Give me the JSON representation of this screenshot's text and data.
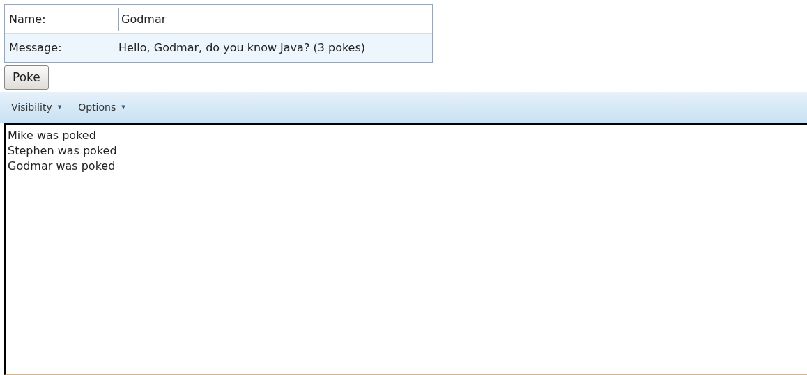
{
  "form": {
    "rows": [
      {
        "kind": "input",
        "label": "Name:",
        "value": "Godmar"
      },
      {
        "kind": "text",
        "label": "Message:",
        "value": "Hello, Godmar, do you know Java? (3 pokes)"
      }
    ]
  },
  "button": "Poke",
  "menubar": [
    {
      "label": "Visibility",
      "caret": "▾"
    },
    {
      "label": "Options",
      "caret": "▾"
    }
  ],
  "log": [
    "Mike was poked",
    "Stephen was poked",
    "Godmar was poked"
  ]
}
